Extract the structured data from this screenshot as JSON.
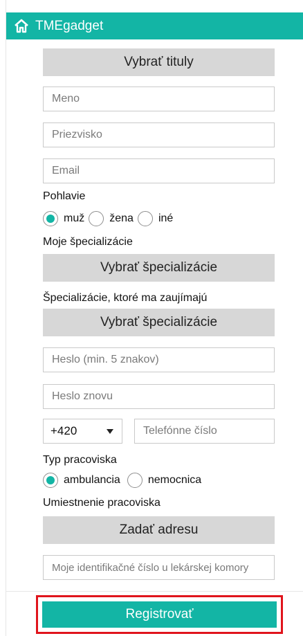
{
  "app": {
    "title": "TMEgadget"
  },
  "buttons": {
    "titles": "Vybrať tituly",
    "specializations": "Vybrať špecializácie",
    "interests": "Vybrať špecializácie",
    "address": "Zadať adresu",
    "register": "Registrovať"
  },
  "fields": {
    "first_name": "Meno",
    "last_name": "Priezvisko",
    "email": "Email",
    "password": "Heslo (min. 5 znakov)",
    "password_again": "Heslo znovu",
    "phone_code": "+420",
    "phone": "Telefónne číslo",
    "chamber_id": "Moje identifikačné číslo u lekárskej komory"
  },
  "labels": {
    "gender": "Pohlavie",
    "my_specializations": "Moje špecializácie",
    "interest_specializations": "Špecializácie, ktoré ma zaujímajú",
    "workplace_type": "Typ pracoviska",
    "workplace_location": "Umiestnenie pracoviska"
  },
  "gender_options": [
    {
      "label": "muž",
      "selected": true
    },
    {
      "label": "žena",
      "selected": false
    },
    {
      "label": "iné",
      "selected": false
    }
  ],
  "workplace_options": [
    {
      "label": "ambulancia",
      "selected": true
    },
    {
      "label": "nemocnica",
      "selected": false
    }
  ],
  "colors": {
    "accent": "#13b5a5",
    "highlight": "#e0141c",
    "button_gray": "#d7d7d7"
  }
}
